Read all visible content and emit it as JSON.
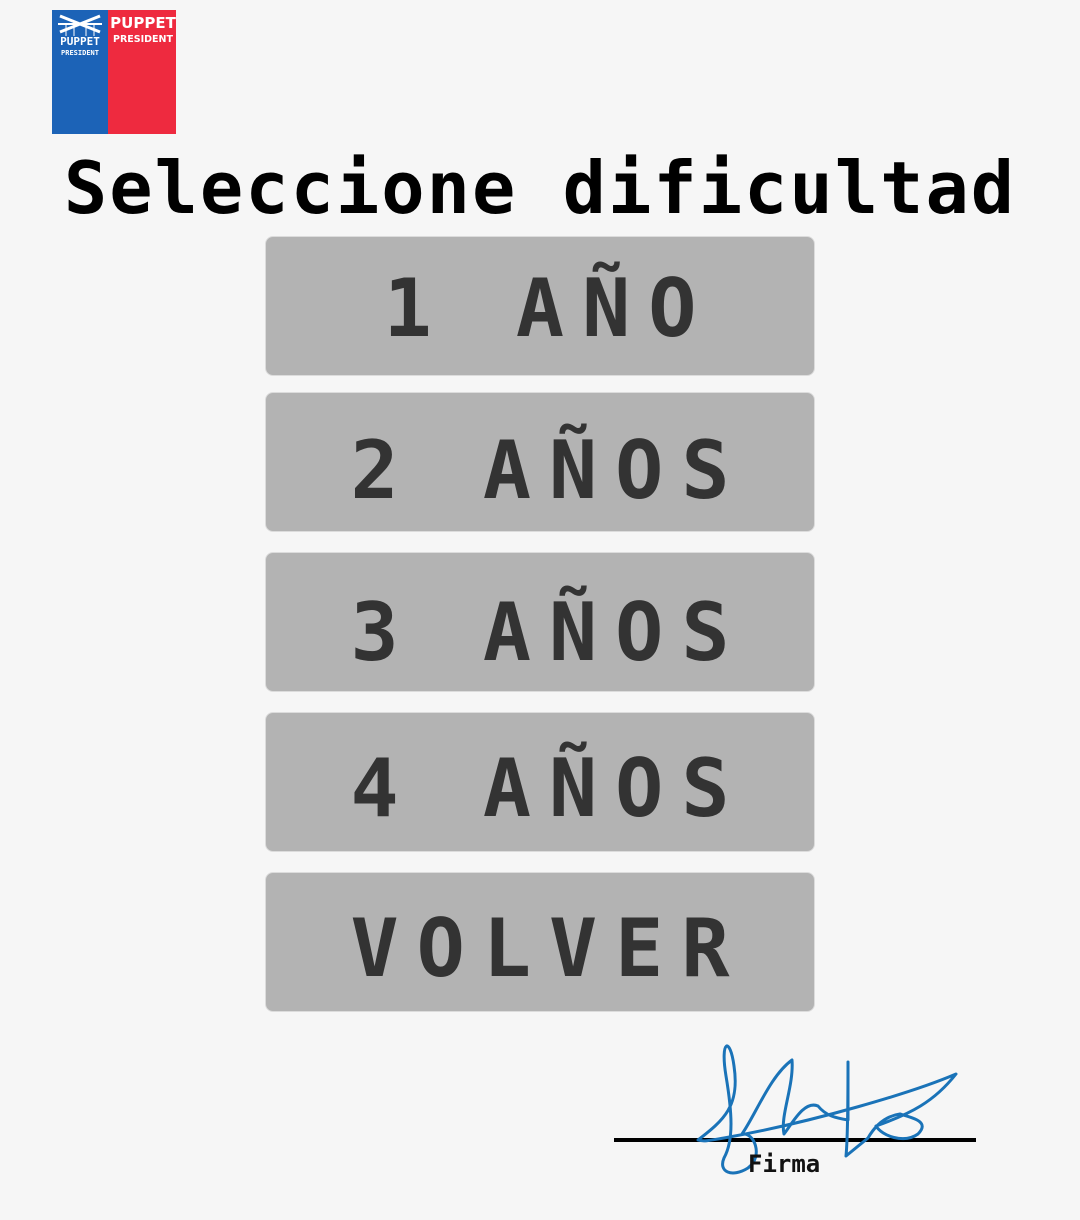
{
  "logo": {
    "name": "puppet-president-logo",
    "left_line1": "PUPPET",
    "left_line2": "PRESIDENT",
    "right_line1": "PUPPET",
    "right_line2": "PRESIDENT",
    "colors": {
      "blue": "#1c63b7",
      "red": "#ee2a3f"
    }
  },
  "page": {
    "title": "Seleccione dificultad"
  },
  "menu": {
    "buttons": [
      {
        "label": "1 AÑO"
      },
      {
        "label": "2 AÑOS"
      },
      {
        "label": "3 AÑOS"
      },
      {
        "label": "4 AÑOS"
      },
      {
        "label": "VOLVER"
      }
    ]
  },
  "signature": {
    "label": "Firma",
    "ink_color": "#1a73b8"
  },
  "colors": {
    "background": "#f6f6f6",
    "button_bg": "#b3b3b3",
    "button_text": "#333333",
    "title_text": "#000000"
  }
}
